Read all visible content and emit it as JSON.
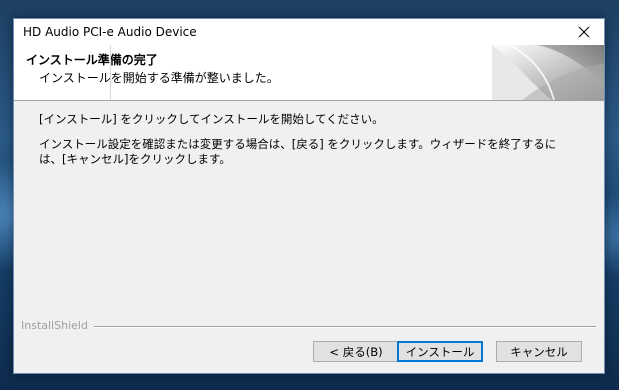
{
  "window": {
    "title": "HD Audio PCI-e Audio Device"
  },
  "header": {
    "title": "インストール準備の完了",
    "subtitle": "インストールを開始する準備が整いました。"
  },
  "body": {
    "line1": "[インストール] をクリックしてインストールを開始してください。",
    "paragraph": "インストール設定を確認または変更する場合は、[戻る] をクリックします。ウィザードを終了するには、[キャンセル]をクリックします。"
  },
  "footer": {
    "brand": "InstallShield",
    "back_label": "< 戻る(B)",
    "install_label": "インストール",
    "cancel_label": "キャンセル"
  },
  "icons": {
    "close": "close-icon",
    "header_graphic": "installshield-graphic"
  }
}
